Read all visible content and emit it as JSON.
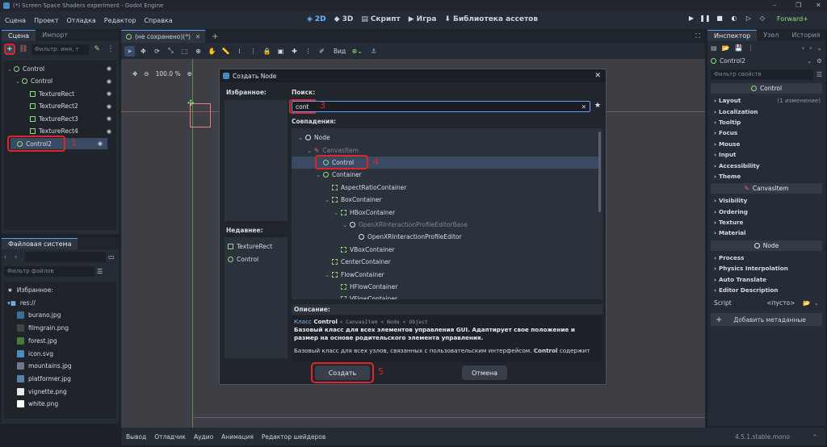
{
  "window": {
    "title": "(*) Screen Space Shaders experiment - Godot Engine"
  },
  "menu": [
    "Сцена",
    "Проект",
    "Отладка",
    "Редактор",
    "Справка"
  ],
  "modes": [
    {
      "label": "2D",
      "icon": "2d-icon"
    },
    {
      "label": "3D",
      "icon": "3d-icon"
    },
    {
      "label": "Скрипт",
      "icon": "script-icon"
    },
    {
      "label": "Игра",
      "icon": "game-icon"
    },
    {
      "label": "Библиотека ассетов",
      "icon": "asset-library-icon"
    }
  ],
  "renderer": "Forward+",
  "scene_dock": {
    "tabs": [
      "Сцена",
      "Импорт"
    ],
    "filter_placeholder": "Фильтр: имя, т",
    "tree": [
      {
        "name": "Control",
        "depth": 0,
        "icon": "control"
      },
      {
        "name": "Control",
        "depth": 1,
        "icon": "control"
      },
      {
        "name": "TextureRect",
        "depth": 2,
        "icon": "texture"
      },
      {
        "name": "TextureRect2",
        "depth": 2,
        "icon": "texture"
      },
      {
        "name": "TextureRect3",
        "depth": 2,
        "icon": "texture"
      },
      {
        "name": "TextureRect4",
        "depth": 2,
        "icon": "texture"
      },
      {
        "name": "Control2",
        "depth": 1,
        "icon": "control",
        "selected": true
      }
    ],
    "marker": "1"
  },
  "fs_dock": {
    "tab": "Файловая система",
    "filter_placeholder": "Фильтр файлов",
    "items": [
      {
        "name": "Избранное:",
        "depth": 0,
        "icon": "star"
      },
      {
        "name": "res://",
        "depth": 0,
        "icon": "folder"
      },
      {
        "name": "burano.jpg",
        "depth": 1,
        "color": "#3a6f96"
      },
      {
        "name": "filmgrain.png",
        "depth": 1,
        "color": "#444444"
      },
      {
        "name": "forest.jpg",
        "depth": 1,
        "color": "#4a7a3a"
      },
      {
        "name": "icon.svg",
        "depth": 1,
        "color": "#478cbf"
      },
      {
        "name": "mountains.jpg",
        "depth": 1,
        "color": "#6b7a8c"
      },
      {
        "name": "platformer.jpg",
        "depth": 1,
        "color": "#5a7fa8"
      },
      {
        "name": "vignette.png",
        "depth": 1,
        "color": "#e8e8e8"
      },
      {
        "name": "white.png",
        "depth": 1,
        "color": "#ffffff"
      }
    ]
  },
  "center": {
    "tab": "(не сохранено)(*)",
    "view_label": "Вид",
    "zoom": "100.0 %"
  },
  "bottom": {
    "tabs": [
      "Вывод",
      "Отладчик",
      "Аудио",
      "Анимация",
      "Редактор шейдеров"
    ],
    "version": "4.5.1.stable.mono"
  },
  "inspector": {
    "tabs": [
      "Инспектор",
      "Узел",
      "История"
    ],
    "node": "Control2",
    "filter_placeholder": "Фильтр свойств",
    "sections": [
      {
        "title": "Control",
        "icon": "control",
        "props": [
          "Layout",
          "Localization",
          "Tooltip",
          "Focus",
          "Mouse",
          "Input",
          "Accessibility",
          "Theme"
        ],
        "layout_note": "(1 изменение)"
      },
      {
        "title": "CanvasItem",
        "icon": "canvas",
        "props": [
          "Visibility",
          "Ordering",
          "Texture",
          "Material"
        ]
      },
      {
        "title": "Node",
        "icon": "node",
        "props": [
          "Process",
          "Physics Interpolation",
          "Auto Translate",
          "Editor Description"
        ]
      }
    ],
    "script_label": "Script",
    "script_value": "<пусто>",
    "add_meta": "Добавить метаданные"
  },
  "dialog": {
    "title": "Создать Node",
    "favorites_label": "Избранное:",
    "recent_label": "Недавнее:",
    "recent": [
      {
        "name": "TextureRect",
        "icon": "texture"
      },
      {
        "name": "Control",
        "icon": "control"
      }
    ],
    "search_label": "Поиск:",
    "search_value": "cont",
    "matches_label": "Совпадения:",
    "results": [
      {
        "name": "Node",
        "depth": 0,
        "icon": "node",
        "dim": false,
        "arrow": true
      },
      {
        "name": "CanvasItem",
        "depth": 1,
        "icon": "canvas",
        "dim": true,
        "arrow": true
      },
      {
        "name": "Control",
        "depth": 2,
        "icon": "control",
        "dim": false,
        "selected": true
      },
      {
        "name": "Container",
        "depth": 2,
        "icon": "control",
        "dim": false,
        "arrow": true
      },
      {
        "name": "AspectRatioContainer",
        "depth": 3,
        "icon": "container"
      },
      {
        "name": "BoxContainer",
        "depth": 3,
        "icon": "container",
        "arrow": true
      },
      {
        "name": "HBoxContainer",
        "depth": 4,
        "icon": "container",
        "arrow": true
      },
      {
        "name": "OpenXRInteractionProfileEditorBase",
        "depth": 5,
        "icon": "node",
        "dim": true,
        "arrow": true
      },
      {
        "name": "OpenXRInteractionProfileEditor",
        "depth": 6,
        "icon": "node"
      },
      {
        "name": "VBoxContainer",
        "depth": 4,
        "icon": "container"
      },
      {
        "name": "CenterContainer",
        "depth": 3,
        "icon": "container"
      },
      {
        "name": "FlowContainer",
        "depth": 3,
        "icon": "container",
        "arrow": true
      },
      {
        "name": "HFlowContainer",
        "depth": 4,
        "icon": "container"
      },
      {
        "name": "VFlowContainer",
        "depth": 4,
        "icon": "container"
      }
    ],
    "description_label": "Описание:",
    "desc_class_word": "Класс",
    "desc_class": "Control",
    "desc_chain": "< CanvasItem < Node < Object",
    "desc_bold": "Базовый класс для всех элементов управления GUI. Адаптирует свое положение и размер на основе родительского элемента управления.",
    "desc_more_a": "Базовый класс для всех узлов, связанных с пользовательским интерфейсом.",
    "desc_more_b": "Control",
    "desc_more_c": "содержит",
    "create_btn": "Создать",
    "cancel_btn": "Отмена",
    "markers": [
      "3",
      "4",
      "5"
    ]
  },
  "colors": {
    "accent": "#5aa1ff",
    "highlight": "#e0242c",
    "control_green": "#8fdc7f"
  }
}
